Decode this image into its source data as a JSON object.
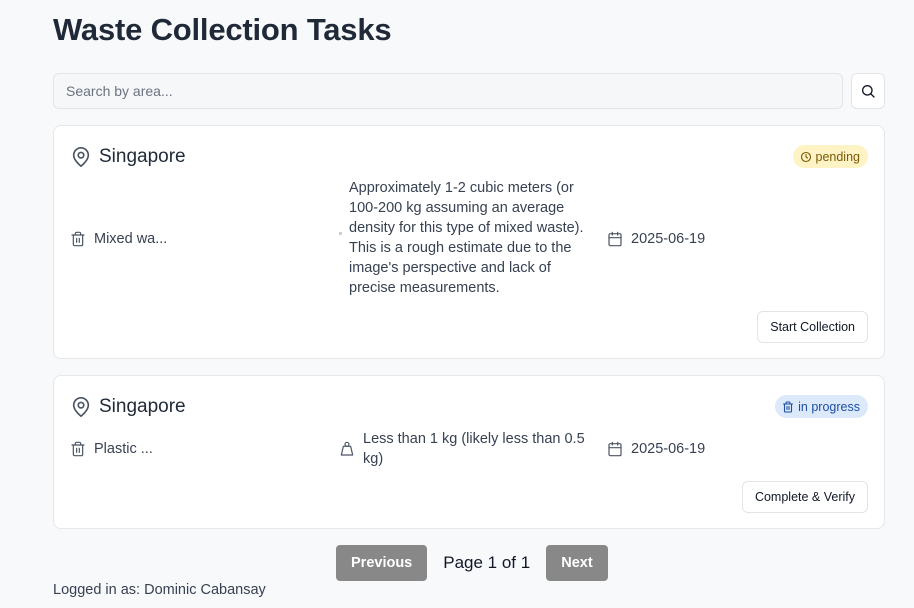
{
  "page": {
    "title": "Waste Collection Tasks"
  },
  "search": {
    "placeholder": "Search by area...",
    "value": ""
  },
  "tasks": [
    {
      "location": "Singapore",
      "status": "pending",
      "waste_type": "Mixed wa...",
      "weight": "Approximately 1-2 cubic meters (or 100-200 kg assuming an average density for this type of mixed waste). This is a rough estimate due to the image's perspective and lack of precise measurements.",
      "date": "2025-06-19",
      "action_label": "Start Collection"
    },
    {
      "location": "Singapore",
      "status": "in progress",
      "waste_type": "Plastic ...",
      "weight": "Less than 1 kg (likely less than 0.5 kg)",
      "date": "2025-06-19",
      "action_label": "Complete & Verify"
    }
  ],
  "pagination": {
    "previous_label": "Previous",
    "info": "Page 1 of 1",
    "next_label": "Next"
  },
  "footer": {
    "logged_in_text": "Logged in as: Dominic Cabansay"
  },
  "colors": {
    "pending_badge_bg": "#fdf3c4",
    "pending_badge_text": "#7a5a07",
    "in_progress_badge_bg": "#dce9fb",
    "in_progress_badge_text": "#1e4fa0",
    "pager_button_bg": "#888888"
  },
  "icons": {
    "search": "search-icon",
    "location": "map-pin-icon",
    "waste_type": "trash-icon",
    "weight": "weight-icon",
    "date": "calendar-icon",
    "pending": "clock-icon",
    "in_progress": "trash-icon"
  }
}
